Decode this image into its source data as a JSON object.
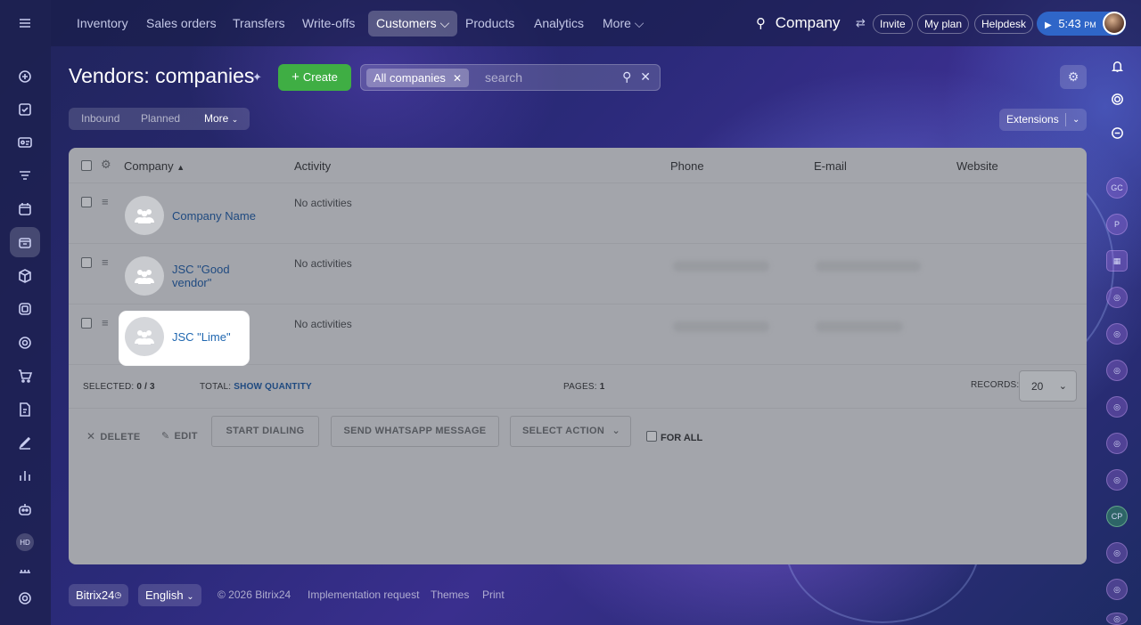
{
  "topnav": {
    "items": [
      {
        "label": "Inventory"
      },
      {
        "label": "Sales orders"
      },
      {
        "label": "Transfers"
      },
      {
        "label": "Write-offs"
      },
      {
        "label": "Customers ⌵"
      },
      {
        "label": "Products"
      },
      {
        "label": "Analytics"
      },
      {
        "label": "More ⌵"
      }
    ],
    "search_label": "Company",
    "invite": "Invite",
    "my_plan": "My plan",
    "helpdesk": "Helpdesk",
    "time": "5:43",
    "time_suffix": "PM"
  },
  "page": {
    "title": "Vendors: companies",
    "create_label": "Create",
    "filter_chip": "All companies",
    "search_placeholder": "search"
  },
  "subtabs": {
    "inbound": "Inbound",
    "planned": "Planned",
    "more": "More"
  },
  "extensions_label": "Extensions",
  "grid": {
    "columns": {
      "company": "Company",
      "activity": "Activity",
      "phone": "Phone",
      "email": "E-mail",
      "website": "Website"
    },
    "rows": [
      {
        "name": "Company Name",
        "activity": "No activities"
      },
      {
        "name": "JSC \"Good vendor\"",
        "activity": "No activities"
      },
      {
        "name": "JSC \"Lime\"",
        "activity": "No activities"
      }
    ],
    "footer": {
      "selected_label": "SELECTED:",
      "selected_value": "0 / 3",
      "total_label": "TOTAL:",
      "total_link": "SHOW QUANTITY",
      "pages_label": "PAGES:",
      "pages_value": "1",
      "records_label": "RECORDS:",
      "records_value": "20"
    },
    "actions": {
      "delete": "DELETE",
      "edit": "EDIT",
      "start_dialing": "START DIALING",
      "whatsapp": "SEND WHATSAPP MESSAGE",
      "select_action": "SELECT ACTION",
      "for_all": "FOR ALL"
    }
  },
  "footer": {
    "brand": "Bitrix24",
    "language": "English",
    "copyright": "© 2026 Bitrix24",
    "impl": "Implementation request",
    "themes": "Themes",
    "print": "Print"
  },
  "sidebar": {
    "hd_badge": "HD"
  },
  "right_rail": {
    "gc": "GC",
    "p": "P",
    "cp": "CP"
  },
  "colors": {
    "create_button": "#3fae44",
    "link": "#1f4a80",
    "time_pill": "#2f66c8"
  }
}
